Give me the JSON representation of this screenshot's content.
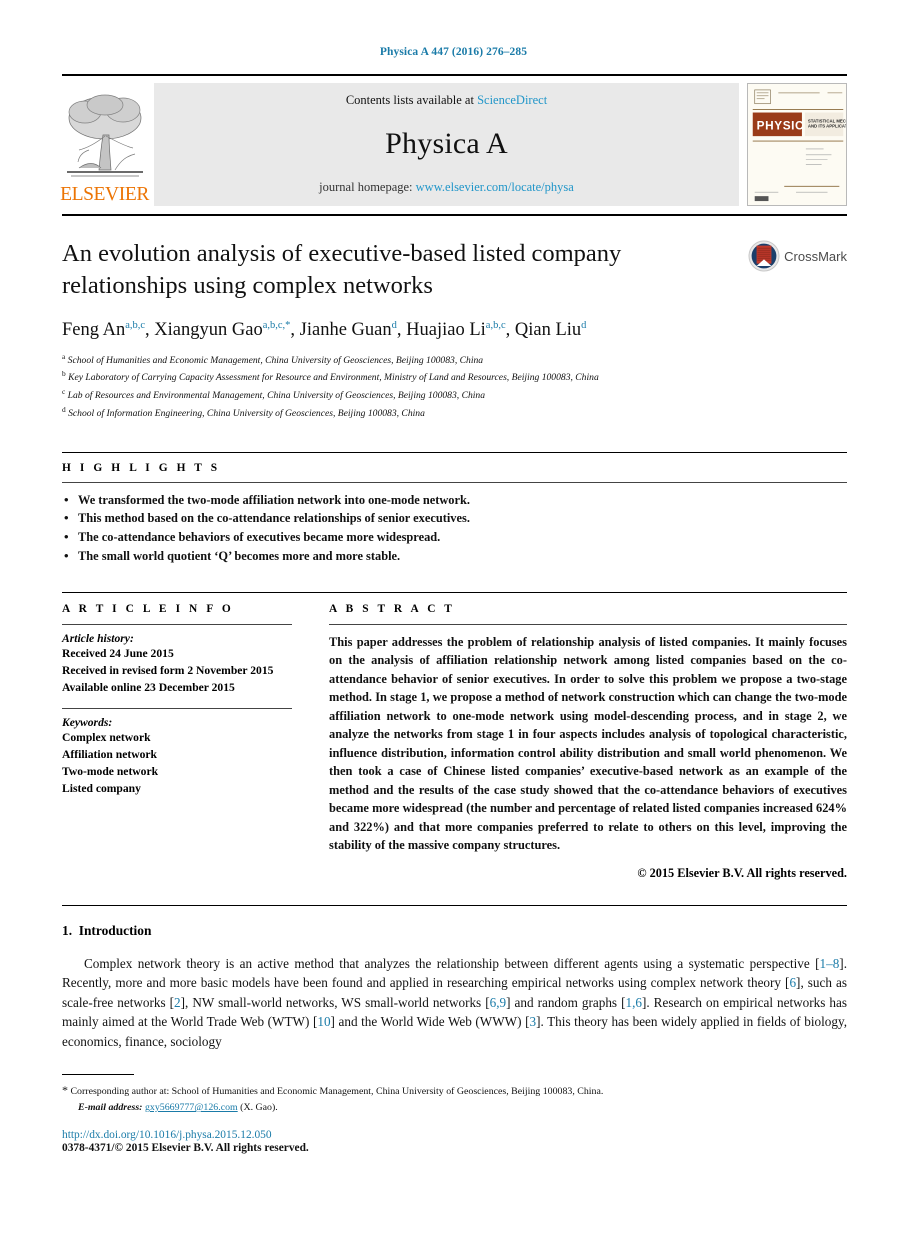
{
  "running_head": "Physica A 447 (2016) 276–285",
  "masthead": {
    "publisher_name": "ELSEVIER",
    "publisher_logo_icon": "elsevier-tree-logo",
    "contents_prefix": "Contents lists available at ",
    "contents_link": "ScienceDirect",
    "journal_name": "Physica A",
    "homepage_prefix": "journal homepage: ",
    "homepage_link": "www.elsevier.com/locate/physa",
    "cover_thumbnail_icon": "journal-cover-thumbnail",
    "cover_title": "PHYSICA",
    "cover_subtitle": "STATISTICAL MECHANICS AND ITS APPLICATIONS"
  },
  "article": {
    "title": "An evolution analysis of executive-based listed company relationships using complex networks",
    "crossmark_label": "CrossMark",
    "crossmark_icon": "crossmark-logo",
    "authors": [
      {
        "name": "Feng An",
        "sup": "a,b,c",
        "corresponding": false
      },
      {
        "name": "Xiangyun Gao",
        "sup": "a,b,c,",
        "corresponding": true
      },
      {
        "name": "Jianhe Guan",
        "sup": "d",
        "corresponding": false
      },
      {
        "name": "Huajiao Li",
        "sup": "a,b,c",
        "corresponding": false
      },
      {
        "name": "Qian Liu",
        "sup": "d",
        "corresponding": false
      }
    ],
    "affiliations": [
      {
        "marker": "a",
        "text": "School of Humanities and Economic Management, China University of Geosciences, Beijing 100083, China"
      },
      {
        "marker": "b",
        "text": "Key Laboratory of Carrying Capacity Assessment for Resource and Environment, Ministry of Land and Resources, Beijing 100083, China"
      },
      {
        "marker": "c",
        "text": "Lab of Resources and Environmental Management, China University of Geosciences, Beijing 100083, China"
      },
      {
        "marker": "d",
        "text": "School of Information Engineering, China University of Geosciences, Beijing 100083, China"
      }
    ]
  },
  "highlights": {
    "heading": "H I G H L I G H T S",
    "items": [
      "We transformed the two-mode affiliation network into one-mode network.",
      "This method based on the co-attendance relationships of senior executives.",
      "The co-attendance behaviors of executives became more widespread.",
      "The small world quotient ‘Q’ becomes more and more stable."
    ]
  },
  "article_info": {
    "heading": "A R T I C L E    I N F O",
    "history_label": "Article history:",
    "history": [
      "Received 24 June 2015",
      "Received in revised form 2 November 2015",
      "Available online 23 December 2015"
    ],
    "keywords_label": "Keywords:",
    "keywords": [
      "Complex network",
      "Affiliation network",
      "Two-mode network",
      "Listed company"
    ]
  },
  "abstract": {
    "heading": "A B S T R A C T",
    "text": "This paper addresses the problem of relationship analysis of listed companies. It mainly focuses on the analysis of affiliation relationship network among listed companies based on the co-attendance behavior of senior executives. In order to solve this problem we propose a two-stage method. In stage 1, we propose a method of network construction which can change the two-mode affiliation network to one-mode network using model-descending process, and in stage 2, we analyze the networks from stage 1 in four aspects includes analysis of topological characteristic, influence distribution, information control ability distribution and small world phenomenon. We then took a case of Chinese listed companies’ executive-based network as an example of the method and the results of the case study showed that the co-attendance behaviors of executives became more widespread (the number and percentage of related listed companies increased 624% and 322%) and that more companies preferred to relate to others on this level, improving the stability of the massive company structures.",
    "copyright": "© 2015 Elsevier B.V. All rights reserved."
  },
  "introduction": {
    "number": "1.",
    "heading": "Introduction",
    "paragraph_parts": [
      {
        "t": "Complex network theory is an active method that analyzes the relationship between different agents using a systematic perspective [",
        "ref": false
      },
      {
        "t": "1–8",
        "ref": true
      },
      {
        "t": "]. Recently, more and more basic models have been found and applied in researching empirical networks using complex network theory [",
        "ref": false
      },
      {
        "t": "6",
        "ref": true
      },
      {
        "t": "], such as scale-free networks [",
        "ref": false
      },
      {
        "t": "2",
        "ref": true
      },
      {
        "t": "], NW small-world networks, WS small-world networks [",
        "ref": false
      },
      {
        "t": "6,9",
        "ref": true
      },
      {
        "t": "] and random graphs [",
        "ref": false
      },
      {
        "t": "1,6",
        "ref": true
      },
      {
        "t": "]. Research on empirical networks has mainly aimed at the World Trade Web (WTW) [",
        "ref": false
      },
      {
        "t": "10",
        "ref": true
      },
      {
        "t": "] and the World Wide Web (WWW) [",
        "ref": false
      },
      {
        "t": "3",
        "ref": true
      },
      {
        "t": "]. This theory has been widely applied in fields of biology, economics, finance, sociology",
        "ref": false
      }
    ]
  },
  "footer": {
    "star": "*",
    "corresponding_text": "Corresponding author at: School of Humanities and Economic Management, China University of Geosciences, Beijing 100083, China.",
    "email_label": "E-mail address:",
    "email": "gxy5669777@126.com",
    "email_suffix": "(X. Gao).",
    "doi": "http://dx.doi.org/10.1016/j.physa.2015.12.050",
    "issn": "0378-4371/© 2015 Elsevier B.V. All rights reserved."
  },
  "colors": {
    "link": "#2196c9",
    "reference": "#1a7ba8",
    "elsevier_orange": "#ec7404",
    "band_gray": "#e9e9e9"
  }
}
